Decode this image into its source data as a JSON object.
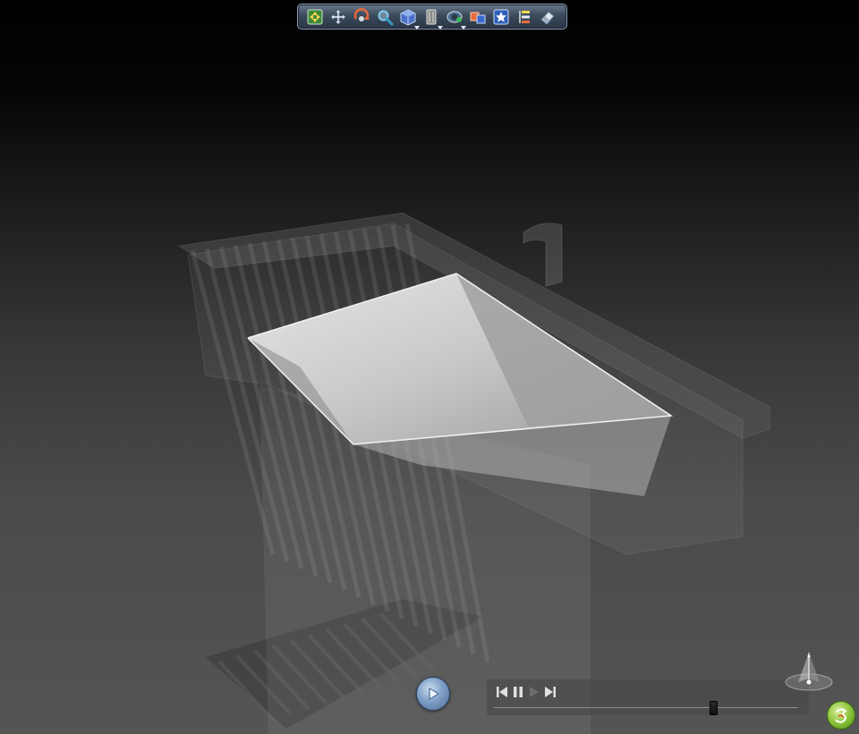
{
  "toolbar": {
    "buttons": [
      {
        "icon": "fit-all-icon",
        "has_menu": false
      },
      {
        "icon": "pan-icon",
        "has_menu": false
      },
      {
        "icon": "rotate-icon",
        "has_menu": false
      },
      {
        "icon": "zoom-icon",
        "has_menu": false
      },
      {
        "icon": "view-cube-icon",
        "has_menu": true
      },
      {
        "icon": "render-style-icon",
        "has_menu": true
      },
      {
        "icon": "material-eye-icon",
        "has_menu": true
      },
      {
        "icon": "animation-icon",
        "has_menu": false
      },
      {
        "icon": "favorite-star-icon",
        "has_menu": false
      },
      {
        "icon": "specification-tree-icon",
        "has_menu": false
      },
      {
        "icon": "eraser-icon",
        "has_menu": false
      }
    ]
  },
  "animation": {
    "play_icon": "play-icon",
    "controls": [
      "previous-frame-icon",
      "pause-icon",
      "next-frame-icon"
    ],
    "progress": 0.72
  },
  "compass_icon": "compass-icon",
  "logo_icon": "3dvia-logo-icon",
  "colors": {
    "toolbar_border": "#8a9db5",
    "play_blue": "#7f9fc6",
    "logo_green": "#8cc43a"
  }
}
